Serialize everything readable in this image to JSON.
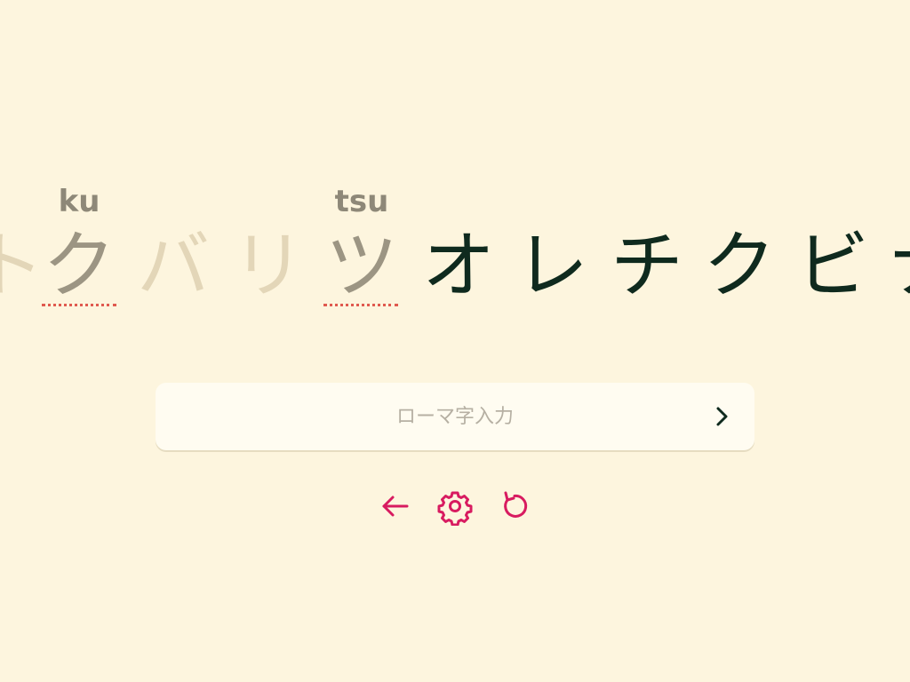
{
  "kana": [
    {
      "char": "ト",
      "state": "done"
    },
    {
      "char": "ク",
      "state": "missed",
      "romaji": "ku"
    },
    {
      "char": "バ",
      "state": "done"
    },
    {
      "char": "リ",
      "state": "done"
    },
    {
      "char": "ツ",
      "state": "missed",
      "romaji": "tsu"
    },
    {
      "char": "オ",
      "state": "todo"
    },
    {
      "char": "レ",
      "state": "todo"
    },
    {
      "char": "チ",
      "state": "todo"
    },
    {
      "char": "ク",
      "state": "todo"
    },
    {
      "char": "ビ",
      "state": "todo"
    },
    {
      "char": "ナ",
      "state": "todo"
    }
  ],
  "input": {
    "placeholder": "ローマ字入力",
    "value": ""
  },
  "colors": {
    "background": "#fdf5de",
    "accent": "#d81b60",
    "missed": "#9c9583",
    "done": "#e3d6b8",
    "todo": "#0f2a1e",
    "miss_underline": "#e05a4f"
  },
  "icons": {
    "submit": "chevron-right-icon",
    "back": "arrow-left-icon",
    "settings": "gear-icon",
    "restart": "restart-icon"
  }
}
